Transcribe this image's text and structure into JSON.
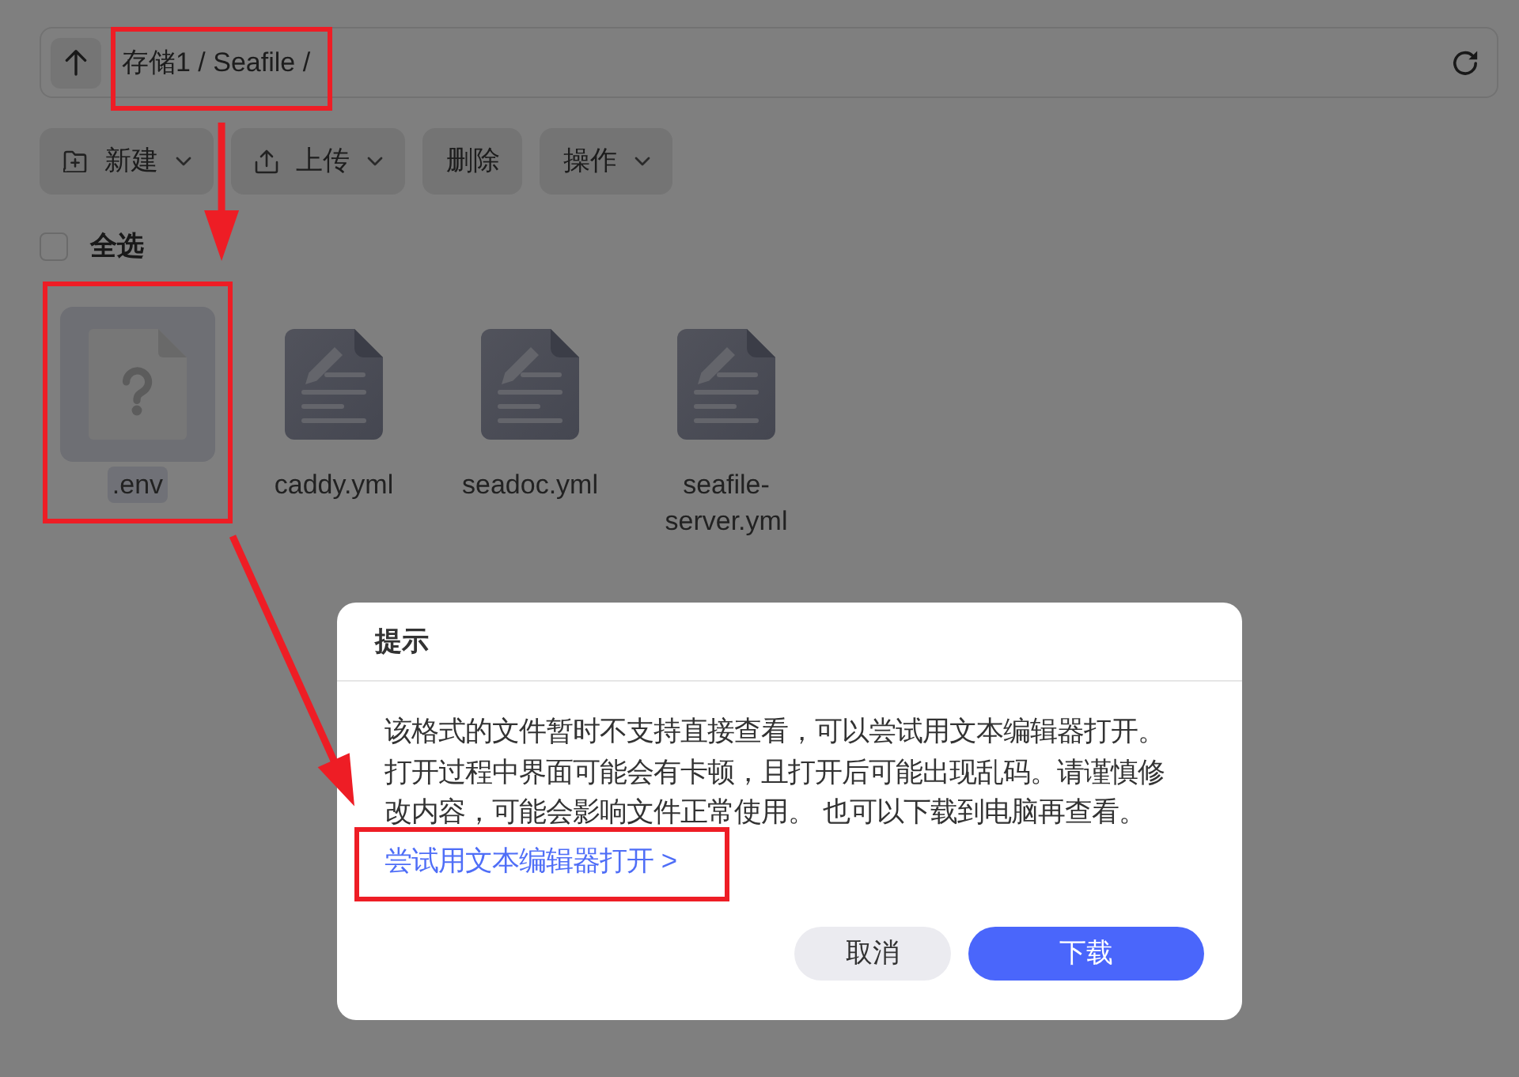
{
  "path_bar": {
    "path": "存储1 / Seafile /",
    "highlighted": true
  },
  "toolbar": [
    {
      "label": "新建",
      "kind": "new",
      "dropdown": true
    },
    {
      "label": "上传",
      "kind": "upload",
      "dropdown": true
    },
    {
      "label": "删除",
      "kind": "plain",
      "dropdown": false
    },
    {
      "label": "操作",
      "kind": "plain",
      "dropdown": true
    }
  ],
  "select_all": {
    "label": "全选",
    "checked": false
  },
  "files": [
    {
      "name": ".env",
      "kind": "unknown",
      "selected": true,
      "highlighted": true
    },
    {
      "name": "caddy.yml",
      "kind": "text",
      "selected": false,
      "highlighted": false
    },
    {
      "name": "seadoc.yml",
      "kind": "text",
      "selected": false,
      "highlighted": false
    },
    {
      "name": "seafile-server.yml",
      "kind": "text",
      "selected": false,
      "highlighted": false
    }
  ],
  "dialog": {
    "title": "提示",
    "message": "该格式的文件暂时不支持直接查看，可以尝试用文本编辑器打开。打开过程中界面可能会有卡顿，且打开后可能出现乱码。请谨慎修改内容，可能会影响文件正常使用。 也可以下载到电脑再查看。",
    "link": {
      "text": "尝试用文本编辑器打开 >",
      "highlighted": true
    },
    "buttons": [
      {
        "label": "取消",
        "kind": "secondary"
      },
      {
        "label": "下载",
        "kind": "primary"
      }
    ]
  }
}
